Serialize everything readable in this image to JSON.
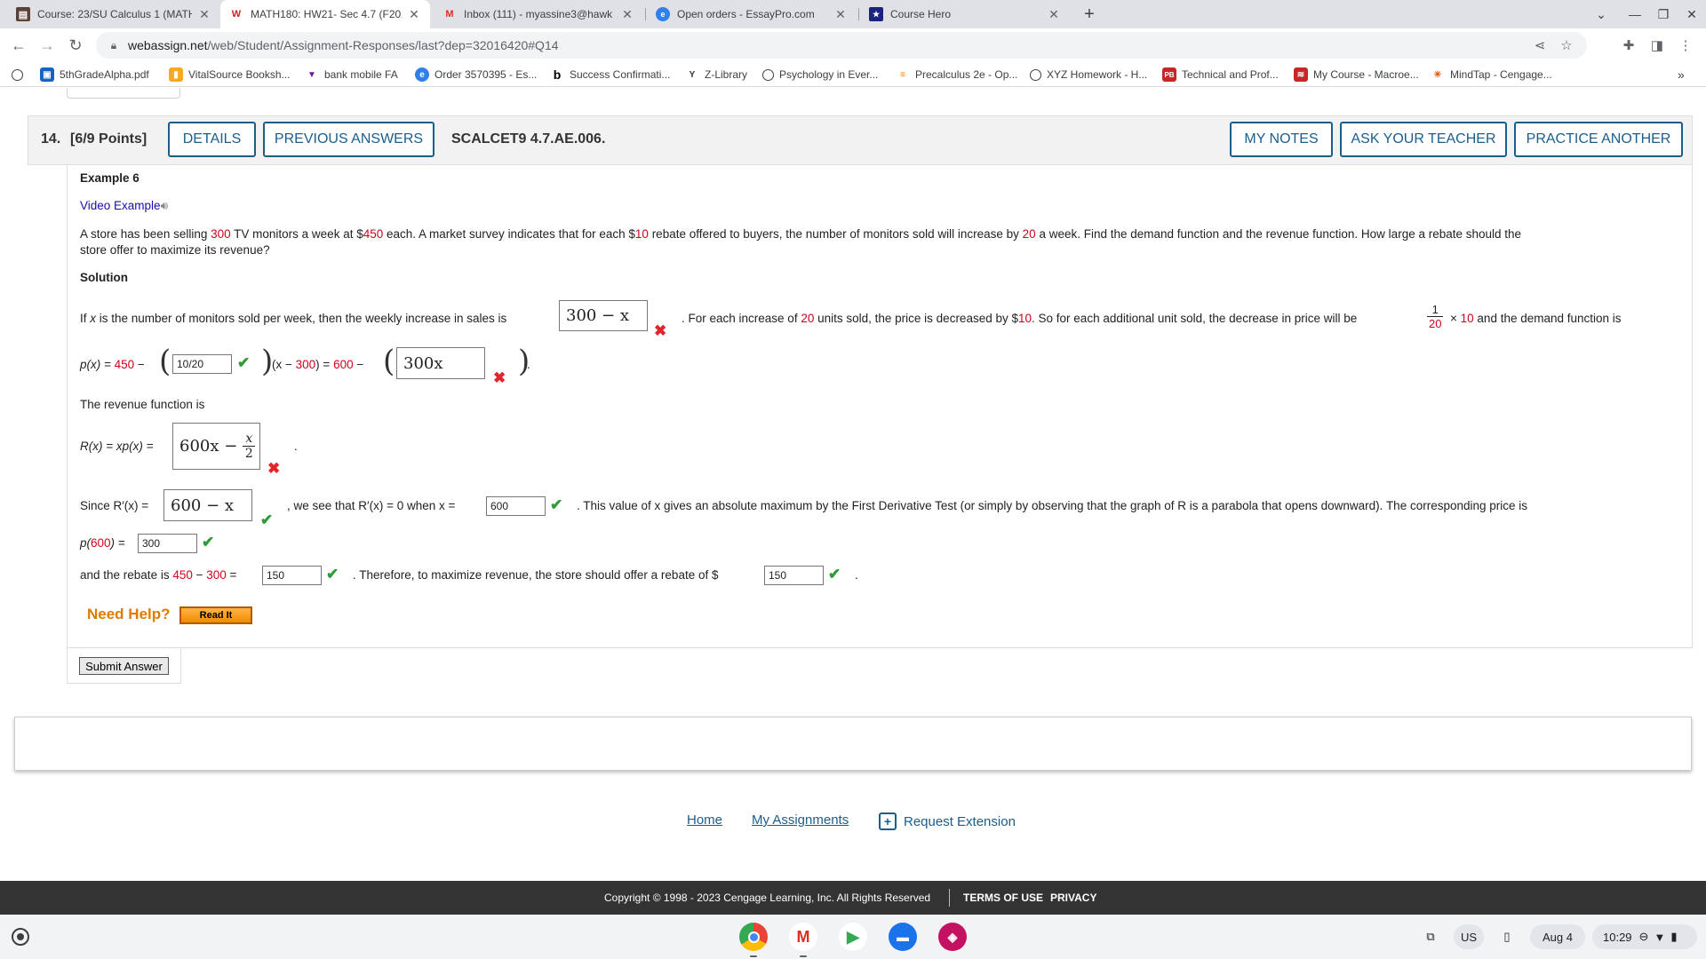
{
  "browser": {
    "tabs": [
      {
        "title": "Course: 23/SU Calculus 1 (MATH",
        "favicon": "book-icon"
      },
      {
        "title": "MATH180: HW21- Sec 4.7 (F202",
        "favicon": "webassign-icon",
        "active": true
      },
      {
        "title": "Inbox (111) - myassine3@hawk",
        "favicon": "gmail-icon"
      },
      {
        "title": "Open orders - EssayPro.com",
        "favicon": "essaypro-icon"
      },
      {
        "title": "Course Hero",
        "favicon": "coursehero-icon"
      }
    ],
    "url_host": "webassign.net",
    "url_path": "/web/Student/Assignment-Responses/last?dep=32016420#Q14",
    "bookmarks": [
      {
        "label": "5thGradeAlpha.pdf",
        "icon": "pdf-icon"
      },
      {
        "label": "VitalSource Booksh...",
        "icon": "vitalsource-icon"
      },
      {
        "label": "bank mobile FA",
        "icon": "bankmobile-icon"
      },
      {
        "label": "Order 3570395 - Es...",
        "icon": "essaypro-icon"
      },
      {
        "label": "Success Confirmati...",
        "icon": "bold-b-icon"
      },
      {
        "label": "Z-Library",
        "icon": "zlibrary-icon"
      },
      {
        "label": "Psychology in Ever...",
        "icon": "globe-icon"
      },
      {
        "label": "Precalculus 2e - Op...",
        "icon": "openstax-icon"
      },
      {
        "label": "XYZ Homework - H...",
        "icon": "globe-icon"
      },
      {
        "label": "Technical and Prof...",
        "icon": "pb-icon"
      },
      {
        "label": "My Course - Macroe...",
        "icon": "mylab-icon"
      },
      {
        "label": "MindTap - Cengage...",
        "icon": "mindtap-icon"
      }
    ]
  },
  "question": {
    "number": "14.",
    "points": "[6/9 Points]",
    "details_label": "DETAILS",
    "prev_answers_label": "PREVIOUS ANSWERS",
    "code": "SCALCET9 4.7.AE.006.",
    "my_notes_label": "MY NOTES",
    "ask_teacher_label": "ASK YOUR TEACHER",
    "practice_label": "PRACTICE ANOTHER",
    "example_title": "Example 6",
    "video_link": "Video Example",
    "problem": {
      "p1": "A store has been selling ",
      "v1": "300",
      "p2": " TV monitors a week at $",
      "v2": "450",
      "p3": " each. A market survey indicates that for each $",
      "v3": "10",
      "p4": " rebate offered to buyers, the number of monitors sold will increase by ",
      "v4": "20",
      "p5": " a week. Find the demand function and the revenue function. How large a rebate should the",
      "line2": "store offer to maximize its revenue?"
    },
    "solution_title": "Solution",
    "s1": {
      "a": "If ",
      "x": "x",
      "b": " is the number of monitors sold per week, then the weekly increase in sales is",
      "box": "300 − x",
      "c": ". For each increase of ",
      "v1": "20",
      "d": " units sold, the price is decreased by $",
      "v2": "10",
      "e": ". So for each additional unit sold, the decrease in price will be",
      "frac_num": "1",
      "frac_den": "20",
      "f": "× ",
      "v3": "10",
      "g": " and the demand function is"
    },
    "s2": {
      "lhs": "p(x) = ",
      "v1": "450",
      "minus": " −",
      "input": "10/20",
      "mid_a": "(x − ",
      "mid_v": "300",
      "mid_b": ") = ",
      "v2": "600",
      "mid_c": " −",
      "box": "300x",
      "end": "."
    },
    "revenue_intro": "The revenue function is",
    "s3": {
      "lhs": "R(x) = xp(x) = ",
      "box_a": "600x −",
      "box_num": "x",
      "box_den": "2",
      "end": "."
    },
    "s4": {
      "a": "Since R′(x) = ",
      "box": "600 − x",
      "b": ", we see that R′(x) = 0 when x = ",
      "input": "600",
      "c": ". This value of x gives an absolute maximum by the First Derivative Test (or simply by observing that the graph of R is a parabola that opens downward). The corresponding price is"
    },
    "s5": {
      "a": "p(",
      "v": "600",
      "b": ") = ",
      "input": "300"
    },
    "s6": {
      "a": "and the rebate is ",
      "v1": "450",
      "minus": " − ",
      "v2": "300",
      "eq": " = ",
      "input1": "150",
      "b": ". Therefore, to maximize revenue, the store should offer a rebate of $",
      "input2": "150",
      "end": "."
    },
    "need_help": "Need Help?",
    "read_it": "Read It",
    "submit": "Submit Answer"
  },
  "footer": {
    "home": "Home",
    "my_assignments": "My Assignments",
    "request_extension": "Request Extension",
    "copyright": "Copyright © 1998 - 2023 Cengage Learning, Inc. All Rights Reserved",
    "terms": "TERMS OF USE",
    "privacy": "PRIVACY"
  },
  "shelf": {
    "apps": [
      "chrome-icon",
      "gmail-icon",
      "play-store-icon",
      "files-icon",
      "screencast-icon"
    ],
    "locale": "US",
    "date": "Aug 4",
    "time": "10:29"
  },
  "colors": {
    "accent": "#1a5e8c",
    "value_red": "#d0021b",
    "check_green": "#2e9b36",
    "error_red": "#e0262b",
    "help_orange": "#e07b00"
  }
}
